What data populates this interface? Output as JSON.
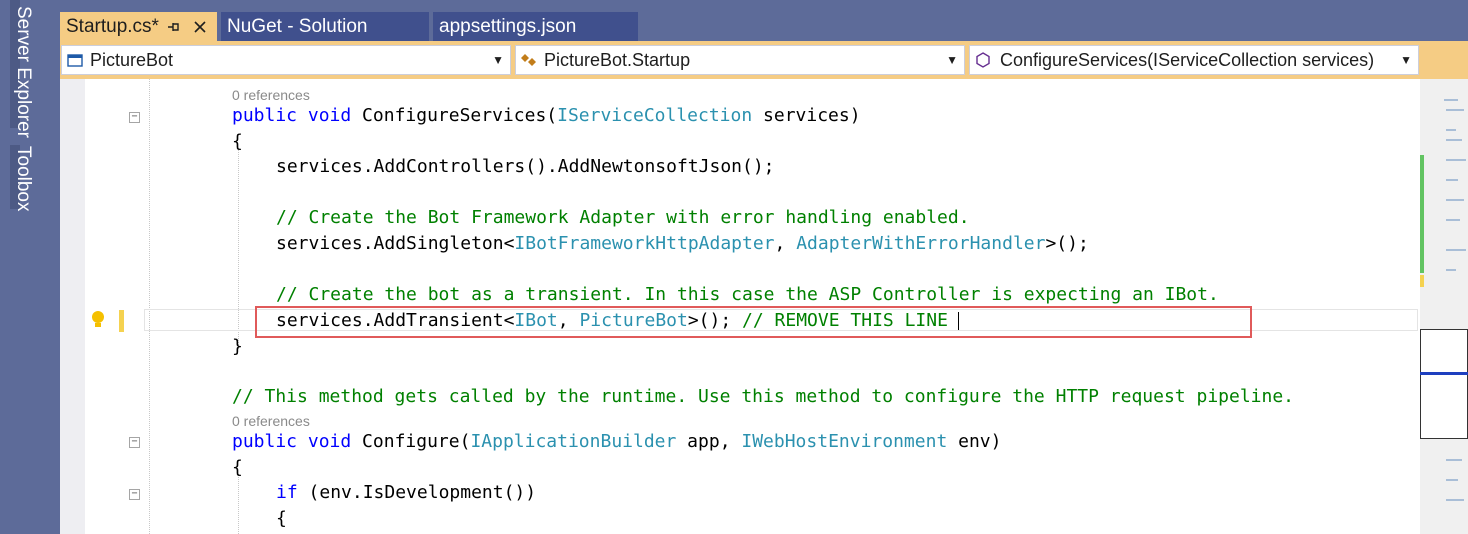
{
  "side_panel": {
    "server_explorer_label": "Server Explorer",
    "toolbox_label": "Toolbox"
  },
  "tabs": [
    {
      "label": "Startup.cs*",
      "active": true
    },
    {
      "label": "NuGet - Solution",
      "active": false
    },
    {
      "label": "appsettings.json",
      "active": false
    }
  ],
  "nav": {
    "project": "PictureBot",
    "class": "PictureBot.Startup",
    "member": "ConfigureServices(IServiceCollection services)"
  },
  "code": {
    "codelens_references": "0 references",
    "line_signature_kw": "public void",
    "line_signature_name": " ConfigureServices(",
    "line_signature_type": "IServiceCollection",
    "line_signature_rest": " services)",
    "brace_open": "{",
    "brace_close": "}",
    "add_controllers": "services.AddControllers().AddNewtonsoftJson();",
    "comment_adapter": "// Create the Bot Framework Adapter with error handling enabled.",
    "singleton_start": "services.AddSingleton<",
    "singleton_type1": "IBotFrameworkHttpAdapter",
    "singleton_sep": ", ",
    "singleton_type2": "AdapterWithErrorHandler",
    "singleton_end": ">();",
    "comment_bot": "// Create the bot as a transient. In this case the ASP Controller is expecting an IBot.",
    "transient_start": "services.AddTransient<",
    "transient_type1": "IBot",
    "transient_sep": ", ",
    "transient_type2": "PictureBot",
    "transient_end": ">(); ",
    "transient_comment": "// REMOVE THIS LINE",
    "comment_configure": "// This method gets called by the runtime. Use this method to configure the HTTP request pipeline.",
    "configure_kw": "public void",
    "configure_name": " Configure(",
    "configure_type1": "IApplicationBuilder",
    "configure_mid": " app, ",
    "configure_type2": "IWebHostEnvironment",
    "configure_end": " env)",
    "if_kw": "if",
    "if_rest": " (env.IsDevelopment())"
  },
  "colors": {
    "accent_tab": "#f5cc84",
    "chrome": "#5d6b99",
    "keyword": "#0000ff",
    "type": "#2b91af",
    "comment": "#008000",
    "highlight_border": "#e05a5a"
  },
  "icons": {
    "pin": "pin-icon",
    "close": "close-icon",
    "lightbulb": "lightbulb-icon"
  }
}
